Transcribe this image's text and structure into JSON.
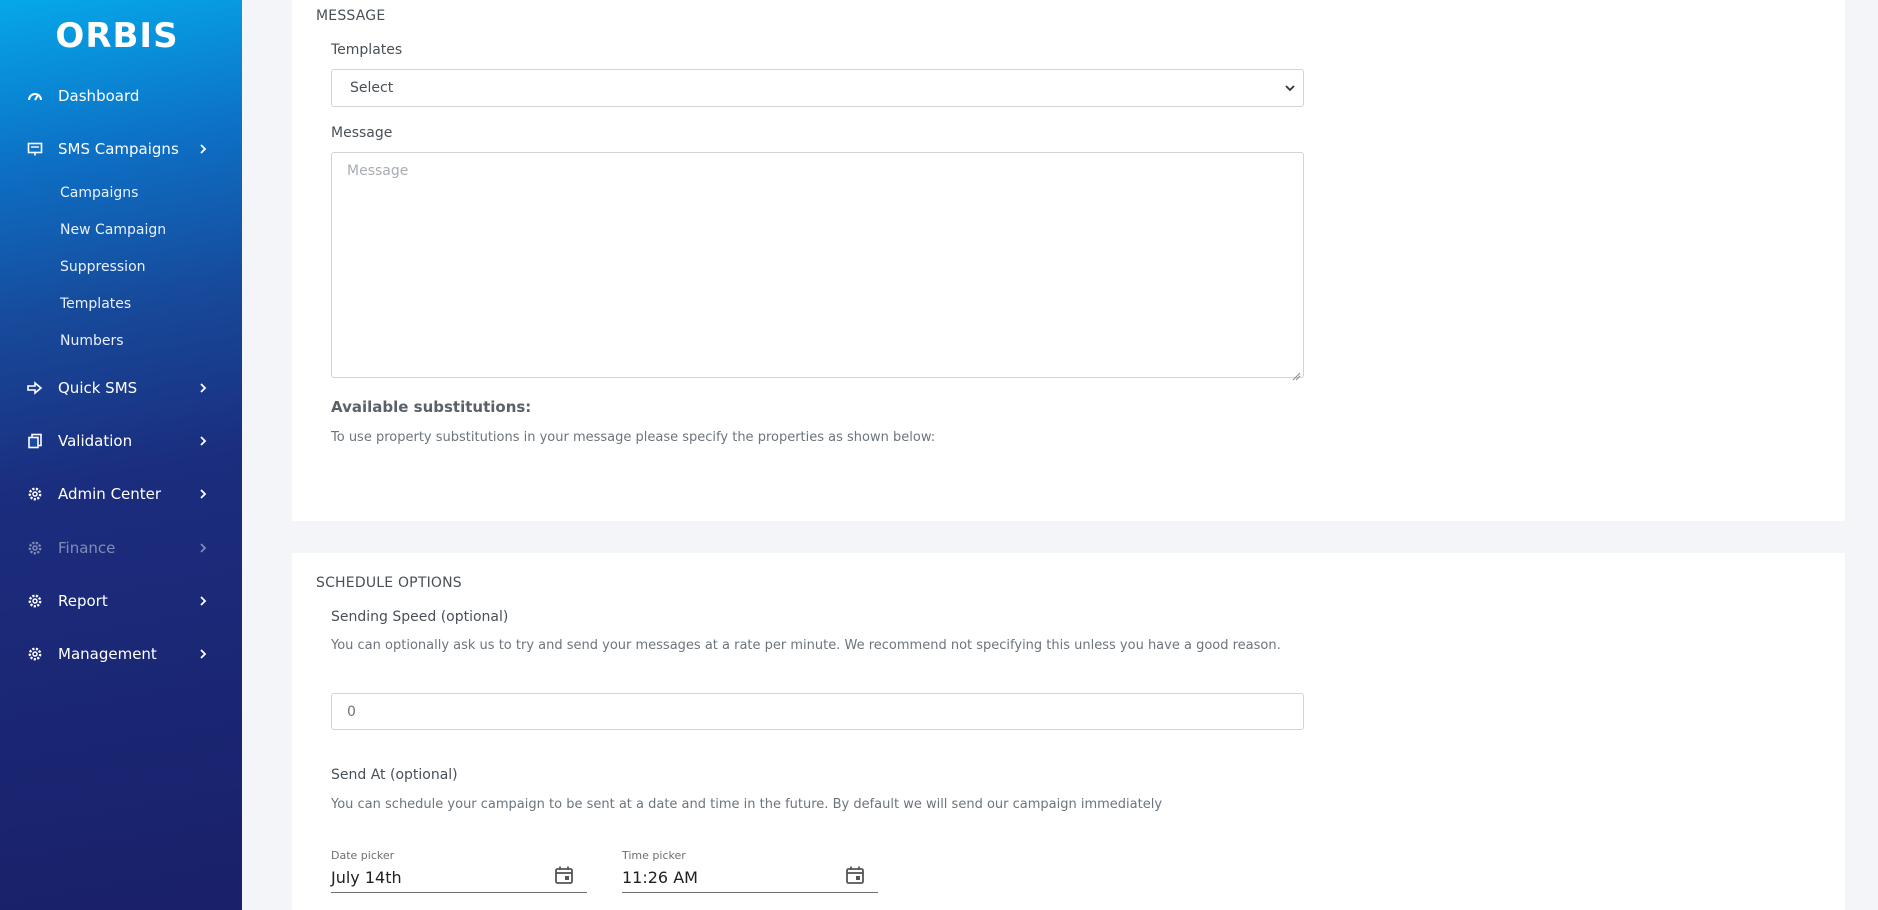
{
  "brand": "ORBIS",
  "sidebar": {
    "items": [
      {
        "label": "Dashboard",
        "icon": "speedometer-icon"
      },
      {
        "label": "SMS Campaigns",
        "icon": "monitor-message-icon"
      },
      {
        "label": "Quick SMS",
        "icon": "arrow-right-icon"
      },
      {
        "label": "Validation",
        "icon": "clipboard-icon"
      },
      {
        "label": "Admin Center",
        "icon": "gear-icon"
      },
      {
        "label": "Finance",
        "icon": "gear-icon"
      },
      {
        "label": "Report",
        "icon": "gear-icon"
      },
      {
        "label": "Management",
        "icon": "gear-icon"
      }
    ],
    "sms_sub_items": [
      "Campaigns",
      "New Campaign",
      "Suppression",
      "Templates",
      "Numbers"
    ]
  },
  "message": {
    "section_title": "MESSAGE",
    "templates_label": "Templates",
    "templates_selected": "Select",
    "message_label": "Message",
    "message_placeholder": "Message",
    "substitutions_title": "Available substitutions:",
    "substitutions_help": "To use property substitutions in your message please specify the properties as shown below:"
  },
  "schedule": {
    "section_title": "SCHEDULE OPTIONS",
    "speed_label": "Sending Speed (optional)",
    "speed_help": "You can optionally ask us to try and send your messages at a rate per minute. We recommend not specifying this unless you have a good reason.",
    "speed_value": "0",
    "send_at_label": "Send At (optional)",
    "send_at_help": "You can schedule your campaign to be sent at a date and time in the future. By default we will send our campaign immediately",
    "date_picker_label": "Date picker",
    "date_value": "July 14th",
    "time_picker_label": "Time picker",
    "time_value": "11:26 AM"
  }
}
